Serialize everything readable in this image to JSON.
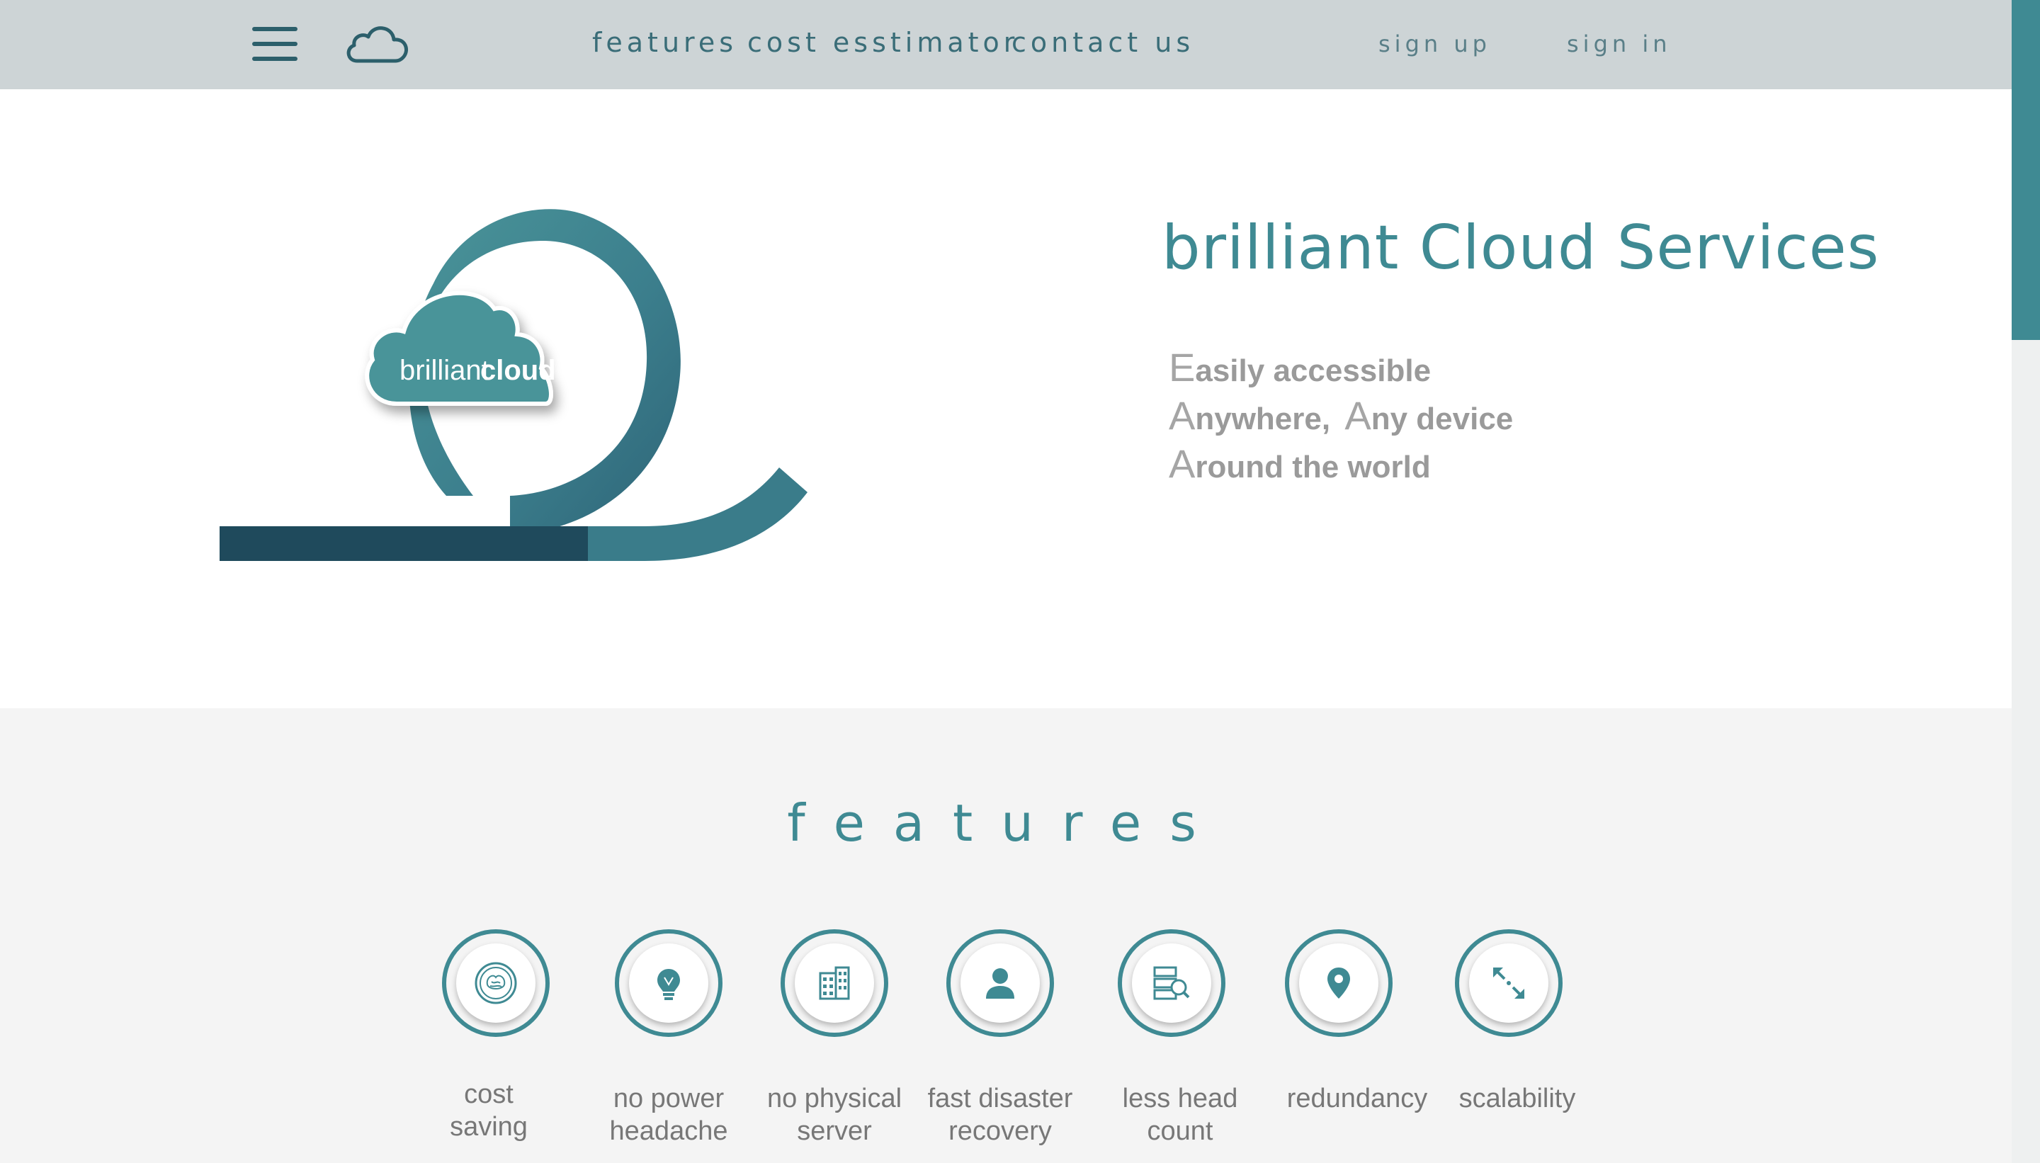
{
  "nav": {
    "links": [
      "features",
      "cost esstimator",
      "contact us"
    ],
    "sign_up": "sign up",
    "sign_in": "sign in"
  },
  "hero": {
    "logo_text_light": "brilliant",
    "logo_text_bold": "cloud",
    "title": "brilliant Cloud Services",
    "taglines": [
      {
        "cap": "E",
        "rest": "asily accessible"
      },
      {
        "cap": "A",
        "rest": "nywhere,"
      },
      {
        "cap": "A",
        "rest": "ny device"
      },
      {
        "cap": "A",
        "rest": "round the world"
      }
    ]
  },
  "features": {
    "heading": "features",
    "items": [
      {
        "label": "cost\nsaving",
        "icon": "brain-coin-icon"
      },
      {
        "label": "no power\nheadache",
        "icon": "lightbulb-icon"
      },
      {
        "label": "no physical\nserver",
        "icon": "building-icon"
      },
      {
        "label": "fast disaster\nrecovery",
        "icon": "person-icon"
      },
      {
        "label": "less head\ncount",
        "icon": "server-search-icon"
      },
      {
        "label": "redundancy",
        "icon": "location-pin-icon"
      },
      {
        "label": "scalability",
        "icon": "expand-arrows-icon"
      }
    ]
  },
  "colors": {
    "accent": "#3f8a93",
    "dark_accent": "#1f4a5c",
    "nav_bg": "#cdd4d6",
    "section_bg": "#f4f4f4"
  }
}
